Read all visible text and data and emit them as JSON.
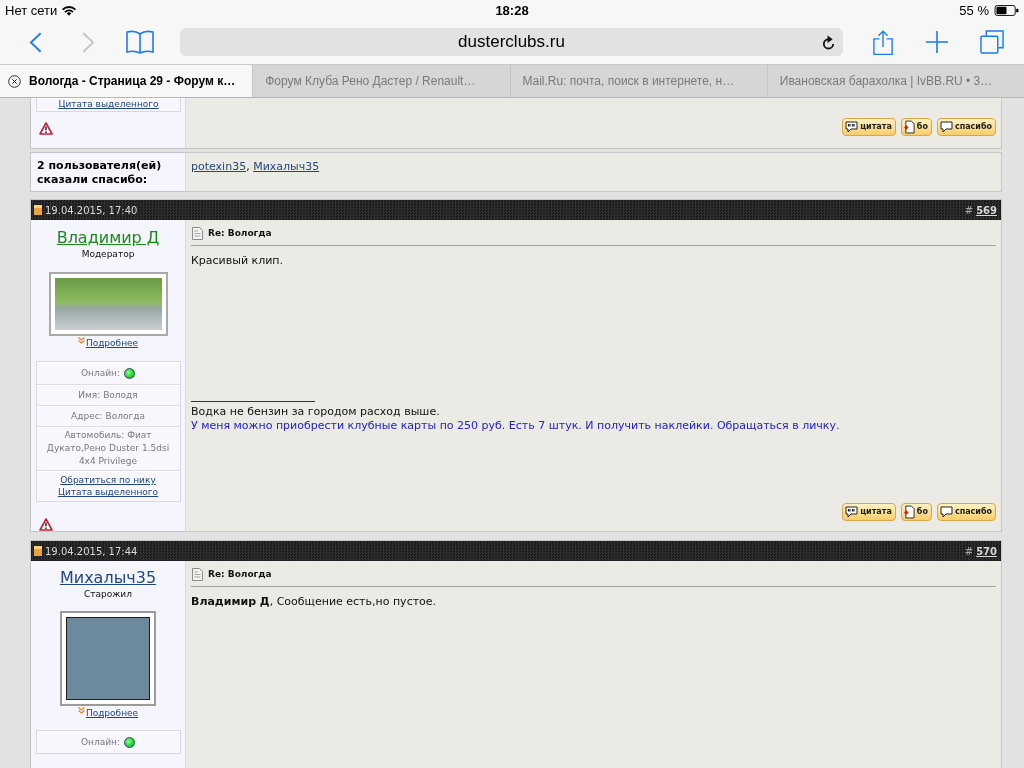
{
  "status_bar": {
    "carrier": "Нет сети",
    "time": "18:28",
    "battery": "55 %"
  },
  "toolbar": {
    "back_enabled": true,
    "forward_enabled": false,
    "address": "dusterclubs.ru"
  },
  "tabs": [
    {
      "title": "Вологда - Страница 29 - Форум к…",
      "selected": true
    },
    {
      "title": "Форум Клуба Рено Дастер / Renault…",
      "selected": false
    },
    {
      "title": "Mail.Ru: почта, поиск в интернете, н…",
      "selected": false
    },
    {
      "title": "Ивановская барахолка | IvBB.RU • 3…",
      "selected": false
    }
  ],
  "previous_post": {
    "profile_links": [
      "Цитата выделенного"
    ],
    "buttons": [
      {
        "kind": "quote",
        "label": "цитата"
      },
      {
        "kind": "document",
        "label": "бо"
      },
      {
        "kind": "bubble",
        "label": "спасибо"
      }
    ]
  },
  "thanks": {
    "label": "2 пользователя(ей) сказали спасибо:",
    "users": [
      "potexin35",
      "Михалыч35"
    ],
    "separator": ", "
  },
  "posts": [
    {
      "date": "19.04.2015, 17:40",
      "number_prefix": "#",
      "number": "569",
      "author": "Владимир Д",
      "color": "#1d8a1d",
      "rank": "Модератор",
      "avatar": {
        "kind": "wide"
      },
      "more_link": "Подробнее",
      "profile": [
        {
          "kind": "online",
          "label": "Онлайн:",
          "online": true
        },
        {
          "kind": "text",
          "text": "Имя: Володя"
        },
        {
          "kind": "text",
          "text": "Адрес: Вологда"
        },
        {
          "kind": "text",
          "text": "Автомобиль: Фиат Дукато,Рено Duster 1.5dsi 4x4 Privilege"
        },
        {
          "kind": "links",
          "links": [
            "Обратиться по нику",
            "Цитата выделенного"
          ]
        }
      ],
      "title": "Re: Вологда",
      "message": "Красивый клип.",
      "signature": [
        {
          "text": "Водка не бензин за городом расход выше.",
          "color": "#111111"
        },
        {
          "text": "У меня можно приобрести клубные карты по 250 руб. Есть 7 штук. И получить наклейки. Обращаться в личку.",
          "color": "#2323c8"
        }
      ],
      "buttons": [
        {
          "kind": "quote",
          "label": "цитата"
        },
        {
          "kind": "document",
          "label": "бо"
        },
        {
          "kind": "bubble",
          "label": "спасибо"
        }
      ]
    },
    {
      "date": "19.04.2015, 17:44",
      "number_prefix": "#",
      "number": "570",
      "author": "Михалыч35",
      "color": "#1f4a80",
      "rank": "Старожил",
      "avatar": {
        "kind": "square"
      },
      "more_link": "Подробнее",
      "profile": [
        {
          "kind": "online",
          "label": "Онлайн:",
          "online": true
        }
      ],
      "title": "Re: Вологда",
      "message": "**Владимир Д**, Сообщение есть,но пустое."
    }
  ]
}
